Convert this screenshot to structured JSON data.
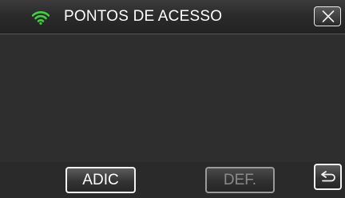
{
  "header": {
    "wifi_icon": "wifi-icon",
    "title": "PONTOS DE ACESSO",
    "close_icon": "close-icon"
  },
  "access_points": [],
  "footer": {
    "add_label": "ADIC",
    "set_label": "DEF.",
    "set_enabled": false,
    "back_icon": "return-icon"
  },
  "colors": {
    "wifi": "#3ed23e",
    "header_bg": "#2b2b2b",
    "content_bg": "#2e2e2e",
    "text": "#ffffff",
    "disabled_text": "#8a8a8a"
  }
}
